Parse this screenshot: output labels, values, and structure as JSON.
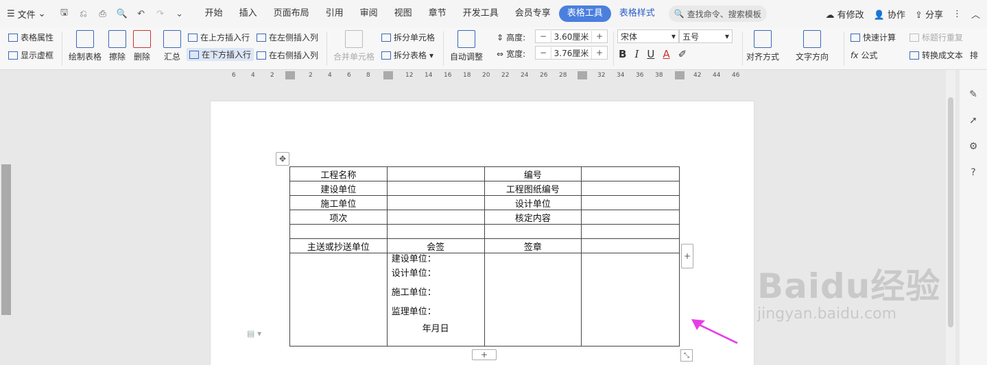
{
  "menubar": {
    "file_label": "文件",
    "tabs": [
      "开始",
      "插入",
      "页面布局",
      "引用",
      "审阅",
      "视图",
      "章节",
      "开发工具",
      "会员专享"
    ],
    "active_tab": "表格工具",
    "style_tab": "表格样式",
    "search_placeholder": "查找命令、搜索模板",
    "modified": "有修改",
    "collab": "协作",
    "share": "分享"
  },
  "ribbon": {
    "table_props": "表格属性",
    "show_grid": "显示虚框",
    "draw_table": "绘制表格",
    "erase": "擦除",
    "delete": "删除",
    "summary": "汇总",
    "insert_above": "在上方插入行",
    "insert_below": "在下方插入行",
    "insert_left": "在左侧插入列",
    "insert_right": "在右侧插入列",
    "merge_cells": "合并单元格",
    "split_cells": "拆分单元格",
    "split_table": "拆分表格",
    "auto_adjust": "自动调整",
    "height_label": "高度:",
    "height_value": "3.60厘米",
    "width_label": "宽度:",
    "width_value": "3.76厘米",
    "font": "宋体",
    "size": "五号",
    "align": "对齐方式",
    "text_dir": "文字方向",
    "quick_calc": "快速计算",
    "formula": "公式",
    "repeat_header": "标题行重复",
    "convert_text": "转换成文本",
    "more": "排"
  },
  "ruler": [
    "6",
    "4",
    "2",
    "2",
    "4",
    "6",
    "8",
    "12",
    "14",
    "16",
    "18",
    "20",
    "22",
    "24",
    "26",
    "28",
    "32",
    "34",
    "36",
    "38",
    "42",
    "44",
    "46"
  ],
  "table": {
    "rows": [
      [
        "工程名称",
        "",
        "编号",
        ""
      ],
      [
        "建设单位",
        "",
        "工程图纸编号",
        ""
      ],
      [
        "施工单位",
        "",
        "设计单位",
        ""
      ],
      [
        "项次",
        "",
        "核定内容",
        ""
      ],
      [
        "",
        "",
        "",
        ""
      ],
      [
        "主送或抄送单位",
        "会签",
        "签章",
        ""
      ]
    ],
    "sign_lines": [
      "建设单位：",
      "设计单位：",
      "施工单位：",
      "监理单位："
    ],
    "date_label": "年月日"
  },
  "watermark": {
    "brand": "Baidu经验",
    "url": "jingyan.baidu.com"
  },
  "colors": {
    "accent": "#4a7fde",
    "arrow": "#e83ee8"
  }
}
